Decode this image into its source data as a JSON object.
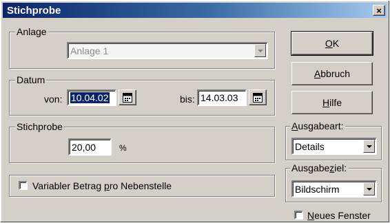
{
  "window": {
    "title": "Stichprobe",
    "close_label": "×"
  },
  "anlage": {
    "legend": "Anlage",
    "value": "Anlage 1"
  },
  "datum": {
    "legend": "Datum",
    "von_label": "von:",
    "von_value": "10.04.02",
    "bis_label": "bis:",
    "bis_value": "14.03.03"
  },
  "stichprobe": {
    "legend": "Stichprobe",
    "value": "20,00",
    "unit": "%"
  },
  "variabler": {
    "pre": "Variabler Betrag ",
    "accel": "p",
    "post": "ro Nebenstelle",
    "checked": false
  },
  "buttons": {
    "ok_accel": "O",
    "ok_rest": "K",
    "abbruch_accel": "A",
    "abbruch_rest": "bbruch",
    "hilfe_accel": "H",
    "hilfe_rest": "ilfe"
  },
  "ausgabeart": {
    "accel": "A",
    "rest": "usgabeart:",
    "value": "Details"
  },
  "ausgabeziel": {
    "pre": "Ausgabe",
    "accel": "z",
    "post": "iel:",
    "value": "Bildschirm"
  },
  "neues_fenster": {
    "accel": "N",
    "rest": "eues Fenster",
    "checked": false
  },
  "colors": {
    "title_start": "#0a246a",
    "title_end": "#a6caf0",
    "face": "#d4d0c8",
    "selection": "#0a246a"
  }
}
